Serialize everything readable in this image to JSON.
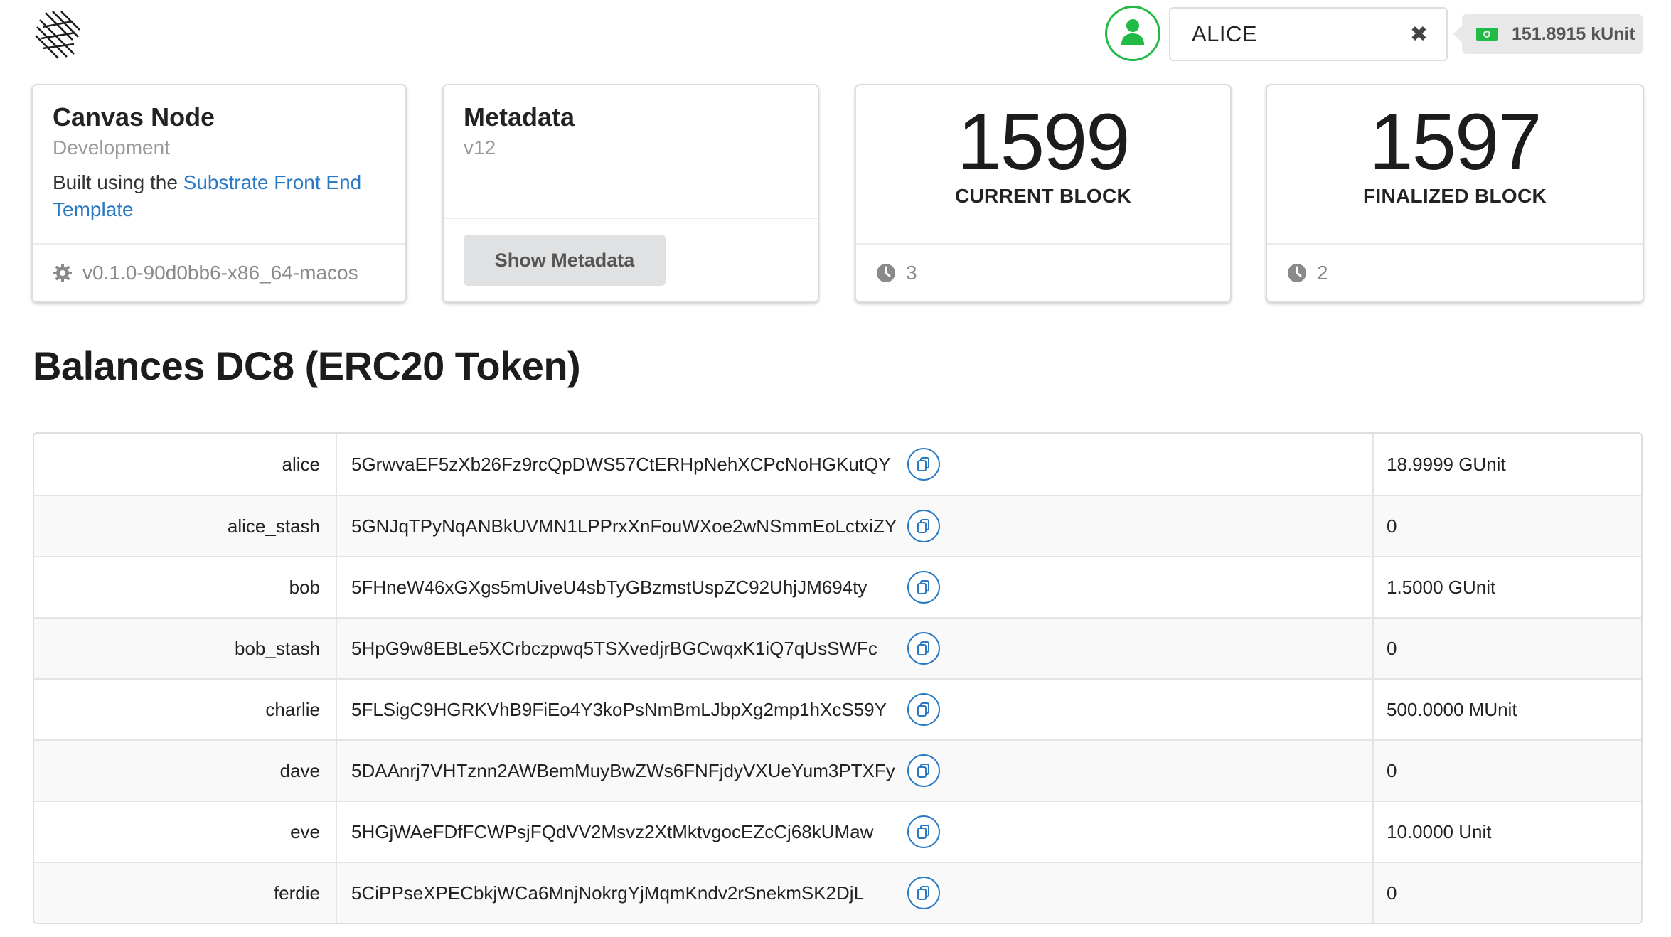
{
  "colors": {
    "accent": "#2a79c4",
    "success": "#21ba45"
  },
  "topbar": {
    "logo_icon": "substrate-logo-icon",
    "account_icon": "user-icon",
    "account_value": "ALICE",
    "clear_icon": "close-icon",
    "balance_icon": "money-icon",
    "balance": "151.8915 kUnit"
  },
  "node_card": {
    "title": "Canvas Node",
    "meta": "Development",
    "desc_prefix": "Built using the ",
    "desc_link": "Substrate Front End Template",
    "version_icon": "gear-icon",
    "version": "v0.1.0-90d0bb6-x86_64-macos"
  },
  "metadata_card": {
    "title": "Metadata",
    "version": "v12",
    "button": "Show Metadata"
  },
  "current_block": {
    "value": "1599",
    "label": "CURRENT BLOCK",
    "timer_icon": "clock-icon",
    "timer": "3"
  },
  "finalized_block": {
    "value": "1597",
    "label": "FINALIZED BLOCK",
    "timer_icon": "clock-icon",
    "timer": "2"
  },
  "balances": {
    "title": "Balances DC8 (ERC20 Token)",
    "copy_icon": "copy-icon",
    "rows": [
      {
        "name": "alice",
        "address": "5GrwvaEF5zXb26Fz9rcQpDWS57CtERHpNehXCPcNoHGKutQY",
        "balance": "18.9999 GUnit"
      },
      {
        "name": "alice_stash",
        "address": "5GNJqTPyNqANBkUVMN1LPPrxXnFouWXoe2wNSmmEoLctxiZY",
        "balance": "0"
      },
      {
        "name": "bob",
        "address": "5FHneW46xGXgs5mUiveU4sbTyGBzmstUspZC92UhjJM694ty",
        "balance": "1.5000 GUnit"
      },
      {
        "name": "bob_stash",
        "address": "5HpG9w8EBLe5XCrbczpwq5TSXvedjrBGCwqxK1iQ7qUsSWFc",
        "balance": "0"
      },
      {
        "name": "charlie",
        "address": "5FLSigC9HGRKVhB9FiEo4Y3koPsNmBmLJbpXg2mp1hXcS59Y",
        "balance": "500.0000 MUnit"
      },
      {
        "name": "dave",
        "address": "5DAAnrj7VHTznn2AWBemMuyBwZWs6FNFjdyVXUeYum3PTXFy",
        "balance": "0"
      },
      {
        "name": "eve",
        "address": "5HGjWAeFDfFCWPsjFQdVV2Msvz2XtMktvgocEZcCj68kUMaw",
        "balance": "10.0000 Unit"
      },
      {
        "name": "ferdie",
        "address": "5CiPPseXPECbkjWCa6MnjNokrgYjMqmKndv2rSnekmSK2DjL",
        "balance": "0"
      }
    ]
  }
}
